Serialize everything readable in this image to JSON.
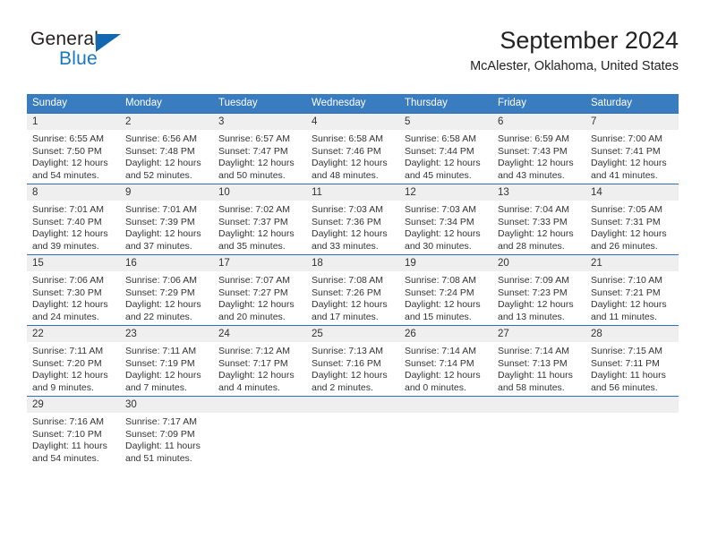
{
  "brand": {
    "name_part1": "General",
    "name_part2": "Blue"
  },
  "header": {
    "title": "September 2024",
    "location": "McAlester, Oklahoma, United States"
  },
  "weekday_headers": [
    "Sunday",
    "Monday",
    "Tuesday",
    "Wednesday",
    "Thursday",
    "Friday",
    "Saturday"
  ],
  "colors": {
    "header_blue": "#3a7cc0",
    "row_border_blue": "#2f6fb5",
    "daynum_band": "#efefef",
    "brand_blue": "#1878c1",
    "text": "#333333"
  },
  "weeks": [
    [
      {
        "day": "1",
        "sunrise": "Sunrise: 6:55 AM",
        "sunset": "Sunset: 7:50 PM",
        "daylight1": "Daylight: 12 hours",
        "daylight2": "and 54 minutes."
      },
      {
        "day": "2",
        "sunrise": "Sunrise: 6:56 AM",
        "sunset": "Sunset: 7:48 PM",
        "daylight1": "Daylight: 12 hours",
        "daylight2": "and 52 minutes."
      },
      {
        "day": "3",
        "sunrise": "Sunrise: 6:57 AM",
        "sunset": "Sunset: 7:47 PM",
        "daylight1": "Daylight: 12 hours",
        "daylight2": "and 50 minutes."
      },
      {
        "day": "4",
        "sunrise": "Sunrise: 6:58 AM",
        "sunset": "Sunset: 7:46 PM",
        "daylight1": "Daylight: 12 hours",
        "daylight2": "and 48 minutes."
      },
      {
        "day": "5",
        "sunrise": "Sunrise: 6:58 AM",
        "sunset": "Sunset: 7:44 PM",
        "daylight1": "Daylight: 12 hours",
        "daylight2": "and 45 minutes."
      },
      {
        "day": "6",
        "sunrise": "Sunrise: 6:59 AM",
        "sunset": "Sunset: 7:43 PM",
        "daylight1": "Daylight: 12 hours",
        "daylight2": "and 43 minutes."
      },
      {
        "day": "7",
        "sunrise": "Sunrise: 7:00 AM",
        "sunset": "Sunset: 7:41 PM",
        "daylight1": "Daylight: 12 hours",
        "daylight2": "and 41 minutes."
      }
    ],
    [
      {
        "day": "8",
        "sunrise": "Sunrise: 7:01 AM",
        "sunset": "Sunset: 7:40 PM",
        "daylight1": "Daylight: 12 hours",
        "daylight2": "and 39 minutes."
      },
      {
        "day": "9",
        "sunrise": "Sunrise: 7:01 AM",
        "sunset": "Sunset: 7:39 PM",
        "daylight1": "Daylight: 12 hours",
        "daylight2": "and 37 minutes."
      },
      {
        "day": "10",
        "sunrise": "Sunrise: 7:02 AM",
        "sunset": "Sunset: 7:37 PM",
        "daylight1": "Daylight: 12 hours",
        "daylight2": "and 35 minutes."
      },
      {
        "day": "11",
        "sunrise": "Sunrise: 7:03 AM",
        "sunset": "Sunset: 7:36 PM",
        "daylight1": "Daylight: 12 hours",
        "daylight2": "and 33 minutes."
      },
      {
        "day": "12",
        "sunrise": "Sunrise: 7:03 AM",
        "sunset": "Sunset: 7:34 PM",
        "daylight1": "Daylight: 12 hours",
        "daylight2": "and 30 minutes."
      },
      {
        "day": "13",
        "sunrise": "Sunrise: 7:04 AM",
        "sunset": "Sunset: 7:33 PM",
        "daylight1": "Daylight: 12 hours",
        "daylight2": "and 28 minutes."
      },
      {
        "day": "14",
        "sunrise": "Sunrise: 7:05 AM",
        "sunset": "Sunset: 7:31 PM",
        "daylight1": "Daylight: 12 hours",
        "daylight2": "and 26 minutes."
      }
    ],
    [
      {
        "day": "15",
        "sunrise": "Sunrise: 7:06 AM",
        "sunset": "Sunset: 7:30 PM",
        "daylight1": "Daylight: 12 hours",
        "daylight2": "and 24 minutes."
      },
      {
        "day": "16",
        "sunrise": "Sunrise: 7:06 AM",
        "sunset": "Sunset: 7:29 PM",
        "daylight1": "Daylight: 12 hours",
        "daylight2": "and 22 minutes."
      },
      {
        "day": "17",
        "sunrise": "Sunrise: 7:07 AM",
        "sunset": "Sunset: 7:27 PM",
        "daylight1": "Daylight: 12 hours",
        "daylight2": "and 20 minutes."
      },
      {
        "day": "18",
        "sunrise": "Sunrise: 7:08 AM",
        "sunset": "Sunset: 7:26 PM",
        "daylight1": "Daylight: 12 hours",
        "daylight2": "and 17 minutes."
      },
      {
        "day": "19",
        "sunrise": "Sunrise: 7:08 AM",
        "sunset": "Sunset: 7:24 PM",
        "daylight1": "Daylight: 12 hours",
        "daylight2": "and 15 minutes."
      },
      {
        "day": "20",
        "sunrise": "Sunrise: 7:09 AM",
        "sunset": "Sunset: 7:23 PM",
        "daylight1": "Daylight: 12 hours",
        "daylight2": "and 13 minutes."
      },
      {
        "day": "21",
        "sunrise": "Sunrise: 7:10 AM",
        "sunset": "Sunset: 7:21 PM",
        "daylight1": "Daylight: 12 hours",
        "daylight2": "and 11 minutes."
      }
    ],
    [
      {
        "day": "22",
        "sunrise": "Sunrise: 7:11 AM",
        "sunset": "Sunset: 7:20 PM",
        "daylight1": "Daylight: 12 hours",
        "daylight2": "and 9 minutes."
      },
      {
        "day": "23",
        "sunrise": "Sunrise: 7:11 AM",
        "sunset": "Sunset: 7:19 PM",
        "daylight1": "Daylight: 12 hours",
        "daylight2": "and 7 minutes."
      },
      {
        "day": "24",
        "sunrise": "Sunrise: 7:12 AM",
        "sunset": "Sunset: 7:17 PM",
        "daylight1": "Daylight: 12 hours",
        "daylight2": "and 4 minutes."
      },
      {
        "day": "25",
        "sunrise": "Sunrise: 7:13 AM",
        "sunset": "Sunset: 7:16 PM",
        "daylight1": "Daylight: 12 hours",
        "daylight2": "and 2 minutes."
      },
      {
        "day": "26",
        "sunrise": "Sunrise: 7:14 AM",
        "sunset": "Sunset: 7:14 PM",
        "daylight1": "Daylight: 12 hours",
        "daylight2": "and 0 minutes."
      },
      {
        "day": "27",
        "sunrise": "Sunrise: 7:14 AM",
        "sunset": "Sunset: 7:13 PM",
        "daylight1": "Daylight: 11 hours",
        "daylight2": "and 58 minutes."
      },
      {
        "day": "28",
        "sunrise": "Sunrise: 7:15 AM",
        "sunset": "Sunset: 7:11 PM",
        "daylight1": "Daylight: 11 hours",
        "daylight2": "and 56 minutes."
      }
    ],
    [
      {
        "day": "29",
        "sunrise": "Sunrise: 7:16 AM",
        "sunset": "Sunset: 7:10 PM",
        "daylight1": "Daylight: 11 hours",
        "daylight2": "and 54 minutes."
      },
      {
        "day": "30",
        "sunrise": "Sunrise: 7:17 AM",
        "sunset": "Sunset: 7:09 PM",
        "daylight1": "Daylight: 11 hours",
        "daylight2": "and 51 minutes."
      },
      {
        "day": "",
        "sunrise": "",
        "sunset": "",
        "daylight1": "",
        "daylight2": ""
      },
      {
        "day": "",
        "sunrise": "",
        "sunset": "",
        "daylight1": "",
        "daylight2": ""
      },
      {
        "day": "",
        "sunrise": "",
        "sunset": "",
        "daylight1": "",
        "daylight2": ""
      },
      {
        "day": "",
        "sunrise": "",
        "sunset": "",
        "daylight1": "",
        "daylight2": ""
      },
      {
        "day": "",
        "sunrise": "",
        "sunset": "",
        "daylight1": "",
        "daylight2": ""
      }
    ]
  ]
}
